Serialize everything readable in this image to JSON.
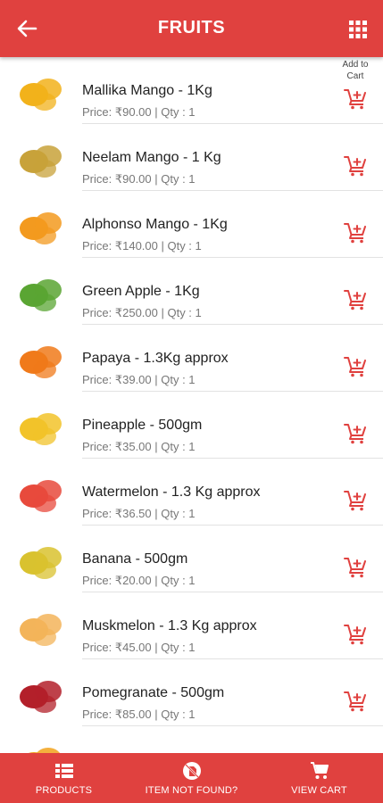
{
  "header": {
    "title": "FRUITS"
  },
  "add_to_cart_label": "Add to Cart",
  "colors": {
    "brand": "#e0413f"
  },
  "items": [
    {
      "name": "Mallika Mango - 1Kg",
      "meta": "Price: ₹90.00 | Qty : 1",
      "icon": "mango-image",
      "fill": "#f2b21b"
    },
    {
      "name": "Neelam Mango - 1 Kg",
      "meta": "Price: ₹90.00 | Qty : 1",
      "icon": "mango-crate-image",
      "fill": "#c8a23a"
    },
    {
      "name": "Alphonso Mango - 1Kg",
      "meta": "Price: ₹140.00 | Qty : 1",
      "icon": "mango-image",
      "fill": "#f39a1f"
    },
    {
      "name": "Green Apple - 1Kg",
      "meta": "Price: ₹250.00 | Qty : 1",
      "icon": "apple-image",
      "fill": "#5aa533"
    },
    {
      "name": "Papaya - 1.3Kg approx",
      "meta": "Price: ₹39.00 | Qty : 1",
      "icon": "papaya-image",
      "fill": "#f07a1a"
    },
    {
      "name": "Pineapple - 500gm",
      "meta": "Price: ₹35.00 | Qty : 1",
      "icon": "pineapple-image",
      "fill": "#f2c32a"
    },
    {
      "name": "Watermelon - 1.3 Kg approx",
      "meta": "Price: ₹36.50 | Qty : 1",
      "icon": "watermelon-image",
      "fill": "#e84a3c"
    },
    {
      "name": "Banana - 500gm",
      "meta": "Price: ₹20.00 | Qty : 1",
      "icon": "banana-image",
      "fill": "#d9c22f"
    },
    {
      "name": "Muskmelon - 1.3 Kg approx",
      "meta": "Price: ₹45.00 | Qty : 1",
      "icon": "muskmelon-image",
      "fill": "#f3b45a"
    },
    {
      "name": "Pomegranate - 500gm",
      "meta": "Price: ₹85.00 | Qty : 1",
      "icon": "pomegranate-image",
      "fill": "#b3202a"
    },
    {
      "name": "",
      "meta": "",
      "icon": "fruit-image",
      "fill": "#f2a21b"
    }
  ],
  "bottom_nav": [
    {
      "label": "PRODUCTS",
      "icon": "list-icon"
    },
    {
      "label": "ITEM NOT FOUND?",
      "icon": "not-found-icon"
    },
    {
      "label": "VIEW CART",
      "icon": "cart-icon"
    }
  ]
}
